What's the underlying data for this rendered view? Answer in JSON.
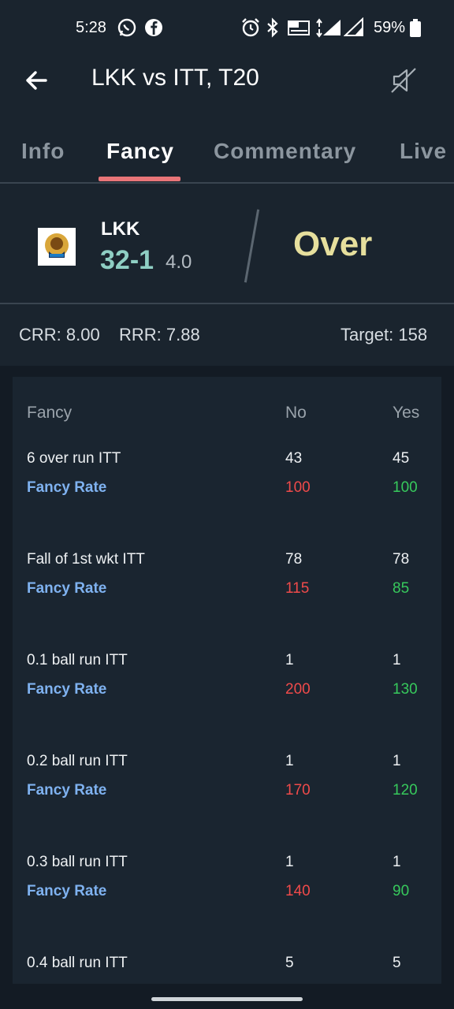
{
  "status_bar": {
    "time": "5:28",
    "battery": "59%",
    "icons": [
      "whatsapp-icon",
      "facebook-icon",
      "alarm-icon",
      "bluetooth-icon",
      "volte-icon",
      "signal-4g-icon",
      "signal-r-icon",
      "battery-icon"
    ]
  },
  "header": {
    "title": "LKK vs ITT, T20",
    "back_icon": "arrow-left-icon",
    "mute_icon": "speaker-muted-icon"
  },
  "tabs": [
    {
      "label": "Info",
      "active": false
    },
    {
      "label": "Fancy",
      "active": true
    },
    {
      "label": "Commentary",
      "active": false
    },
    {
      "label": "Live",
      "active": false
    }
  ],
  "score": {
    "team": "LKK",
    "runs": "32-1",
    "overs": "4.0",
    "status": "Over"
  },
  "rates": {
    "crr": "CRR: 8.00",
    "rrr": "RRR: 7.88",
    "target": "Target: 158"
  },
  "fancy": {
    "headers": {
      "market": "Fancy",
      "no": "No",
      "yes": "Yes"
    },
    "rate_label": "Fancy Rate",
    "rows": [
      {
        "name": "6 over run ITT",
        "no": "43",
        "yes": "45",
        "rate_no": "100",
        "rate_yes": "100"
      },
      {
        "name": "Fall of 1st wkt ITT",
        "no": "78",
        "yes": "78",
        "rate_no": "115",
        "rate_yes": "85"
      },
      {
        "name": "0.1 ball run ITT",
        "no": "1",
        "yes": "1",
        "rate_no": "200",
        "rate_yes": "130"
      },
      {
        "name": "0.2 ball run ITT",
        "no": "1",
        "yes": "1",
        "rate_no": "170",
        "rate_yes": "120"
      },
      {
        "name": "0.3 ball run ITT",
        "no": "1",
        "yes": "1",
        "rate_no": "140",
        "rate_yes": "90"
      },
      {
        "name": "0.4 ball run ITT",
        "no": "5",
        "yes": "5",
        "rate_no": "",
        "rate_yes": ""
      }
    ]
  },
  "colors": {
    "background": "#131b24",
    "panel": "#1a242e",
    "tab_indicator": "#e87578",
    "runs": "#8fcfc4",
    "status": "#e6df9d",
    "rate_label": "#7fb2f0",
    "no": "#ef4a4a",
    "yes": "#37c95c"
  }
}
